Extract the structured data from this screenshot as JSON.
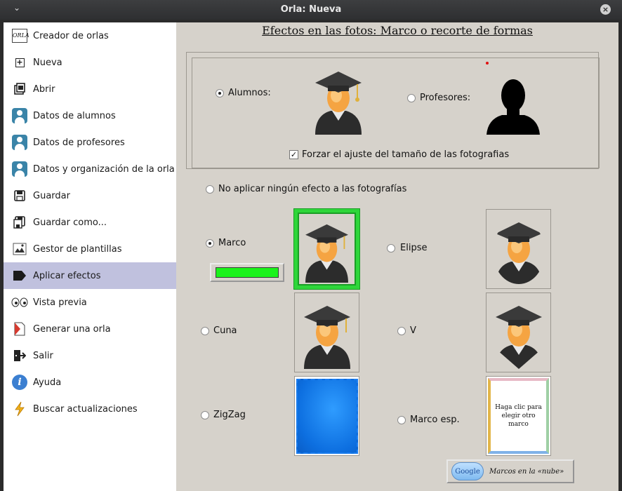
{
  "window": {
    "title": "Orla: Nueva"
  },
  "sidebar": {
    "items": [
      {
        "label": "Creador de orlas",
        "icon": "orla-logo-icon"
      },
      {
        "label": "Nueva",
        "icon": "new-file-icon"
      },
      {
        "label": "Abrir",
        "icon": "open-folder-icon"
      },
      {
        "label": "Datos de alumnos",
        "icon": "user-icon"
      },
      {
        "label": "Datos de profesores",
        "icon": "user-icon"
      },
      {
        "label": "Datos y organización de la orla",
        "icon": "user-icon"
      },
      {
        "label": "Guardar",
        "icon": "save-icon"
      },
      {
        "label": "Guardar como...",
        "icon": "save-as-icon"
      },
      {
        "label": "Gestor de plantillas",
        "icon": "template-icon"
      },
      {
        "label": "Aplicar efectos",
        "icon": "tag-icon",
        "active": true
      },
      {
        "label": "Vista previa",
        "icon": "eyes-icon"
      },
      {
        "label": "Generar una orla",
        "icon": "document-icon"
      },
      {
        "label": "Salir",
        "icon": "exit-icon"
      },
      {
        "label": "Ayuda",
        "icon": "info-icon"
      },
      {
        "label": "Buscar actualizaciones",
        "icon": "lightning-icon"
      }
    ]
  },
  "main": {
    "title": "Efectos en las fotos: Marco o recorte de formas",
    "target": {
      "alumnos_label": "Alumnos:",
      "profesores_label": "Profesores:",
      "selected": "alumnos",
      "force_fit_label": "Forzar el ajuste del tamaño de las fotografias",
      "force_fit_checked": true
    },
    "effects": {
      "none_label": "No aplicar ningún efecto a las fotografías",
      "marco_label": "Marco",
      "elipse_label": "Elipse",
      "cuna_label": "Cuna",
      "v_label": "V",
      "zigzag_label": "ZigZag",
      "marco_esp_label": "Marco esp.",
      "selected": "marco",
      "frame_color": "#1bf21b"
    },
    "special_frame_text": "Haga clic para elegir otro marco",
    "cloud_button": {
      "logo_text": "Google",
      "label": "Marcos en la «nube»"
    }
  },
  "colors": {
    "accent": "#c0c1de",
    "panel": "#d6d2cb",
    "frame_green": "#2ed63a"
  }
}
